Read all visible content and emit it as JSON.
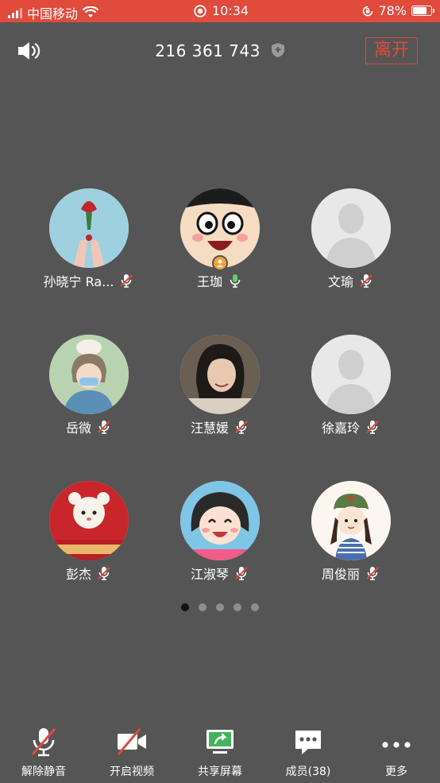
{
  "status_bar": {
    "carrier": "中国移动",
    "time": "10:34",
    "battery": "78%",
    "battery_level": 0.78,
    "bg_color": "#e04b3c",
    "icons": [
      "signal-icon",
      "wifi-icon",
      "record-icon",
      "rotation-lock-icon",
      "battery-icon"
    ]
  },
  "header": {
    "meeting_id": "216 361 743",
    "leave_label": "离开",
    "accent_color": "#e04b3c",
    "icons": [
      "speaker-icon",
      "shield-icon"
    ]
  },
  "participants": [
    {
      "name": "孙晓宁 Ra...",
      "mic": "muted"
    },
    {
      "name": "王珈",
      "mic": "on",
      "host": true
    },
    {
      "name": "文瑜",
      "mic": "muted"
    },
    {
      "name": "岳微",
      "mic": "muted"
    },
    {
      "name": "汪慧媛",
      "mic": "muted"
    },
    {
      "name": "徐嘉玲",
      "mic": "muted"
    },
    {
      "name": "彭杰",
      "mic": "muted"
    },
    {
      "name": "江淑琴",
      "mic": "muted"
    },
    {
      "name": "周俊丽",
      "mic": "muted"
    }
  ],
  "pagination": {
    "pages": 5,
    "current": 1
  },
  "toolbar": {
    "unmute": "解除静音",
    "start_video": "开启视频",
    "share_screen": "共享屏幕",
    "members": "成员(38)",
    "more": "更多"
  }
}
